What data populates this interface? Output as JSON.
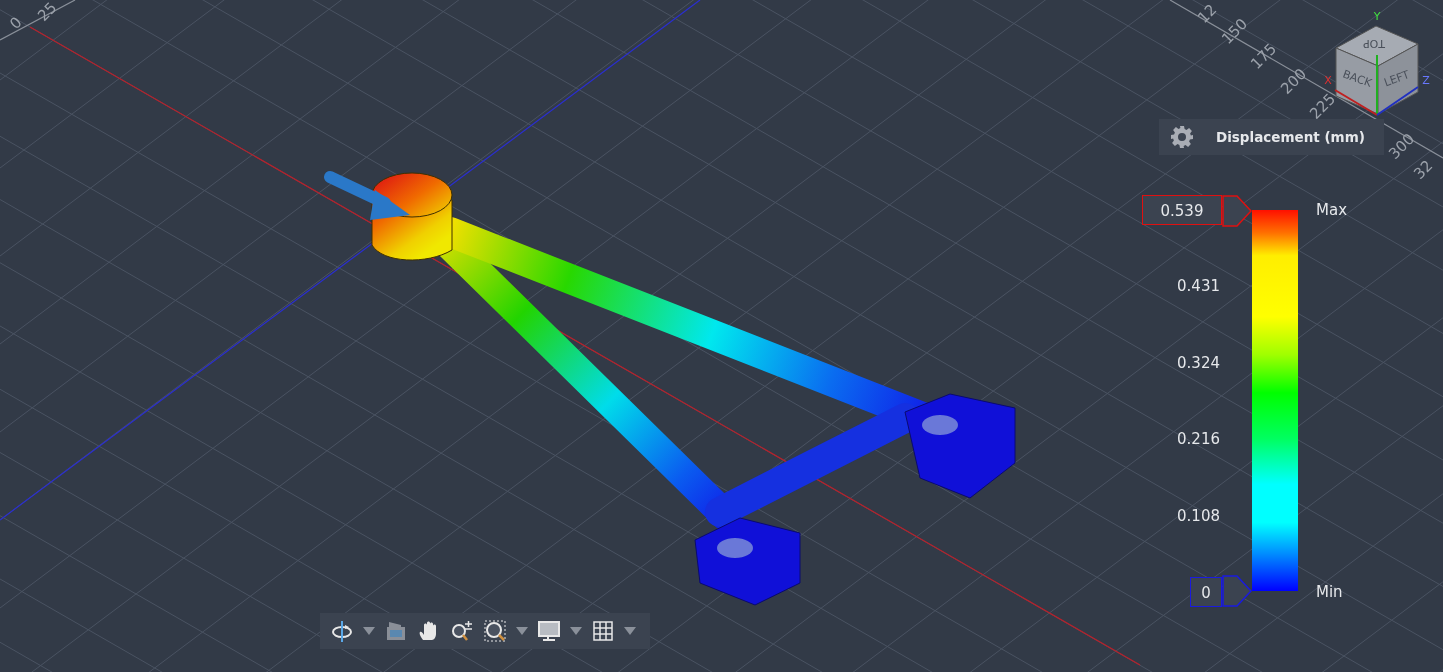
{
  "viewport": {
    "ruler_labels": [
      "0",
      "25",
      "12",
      "150",
      "175",
      "200",
      "225",
      "300",
      "32"
    ]
  },
  "view_cube": {
    "faces": [
      "TOP",
      "BACK",
      "LEFT"
    ],
    "axes": [
      "X",
      "Y",
      "Z"
    ]
  },
  "legend": {
    "title": "Displacement (mm)",
    "max_value": "0.539",
    "max_label": "Max",
    "ticks": [
      "0.431",
      "0.324",
      "0.216",
      "0.108"
    ],
    "min_value": "0",
    "min_label": "Min"
  },
  "toolbar": {
    "tools": [
      {
        "kind": "orbit",
        "dropdown": true
      },
      {
        "kind": "look",
        "dropdown": false
      },
      {
        "kind": "pan",
        "dropdown": false
      },
      {
        "kind": "zoom",
        "dropdown": false
      },
      {
        "kind": "zoom-window",
        "dropdown": true
      },
      {
        "kind": "display",
        "dropdown": true
      },
      {
        "kind": "grid",
        "dropdown": true
      }
    ]
  }
}
